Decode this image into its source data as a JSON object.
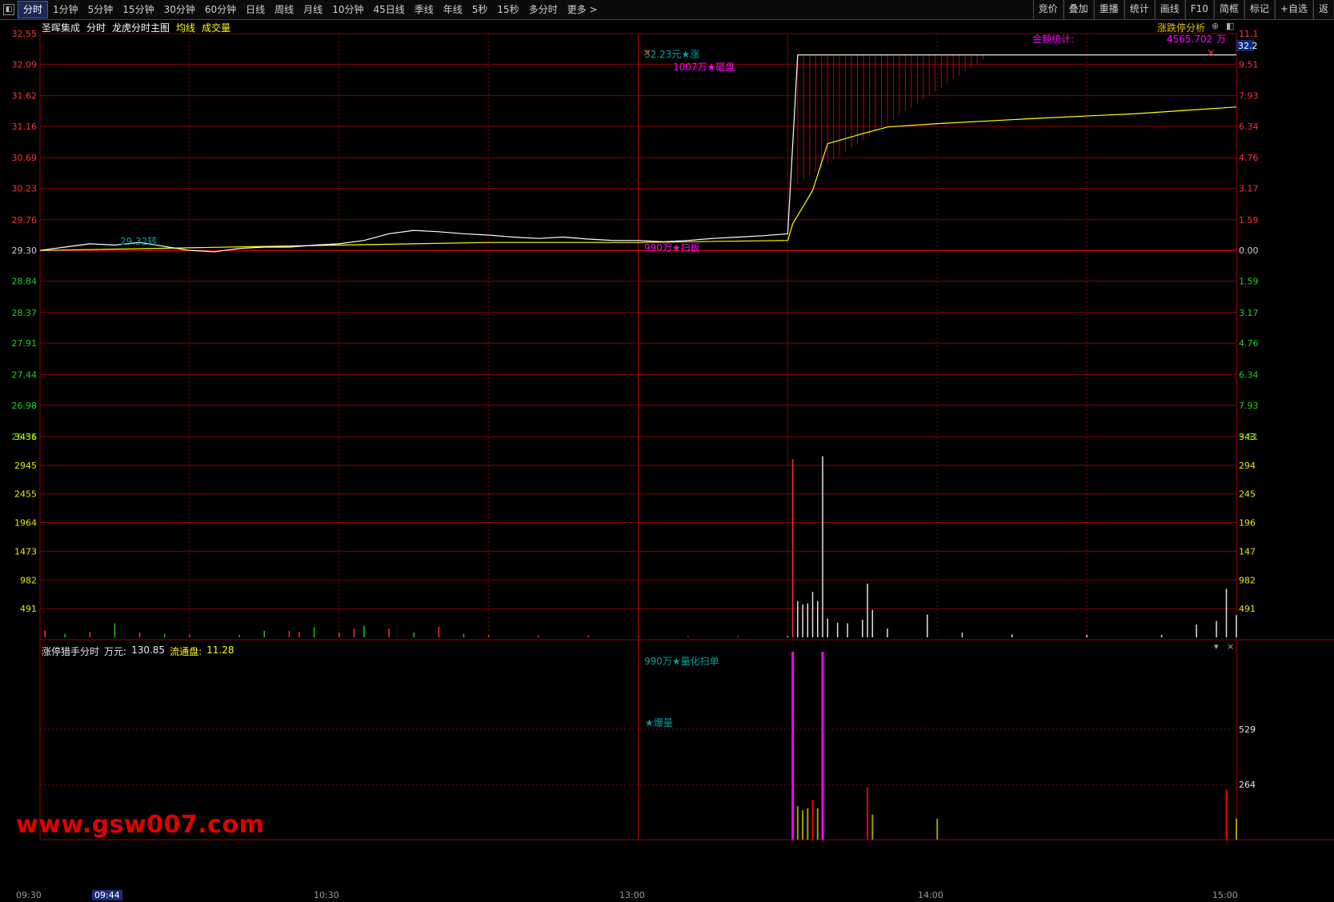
{
  "toolbar": {
    "tabs": [
      "分时",
      "1分钟",
      "5分钟",
      "15分钟",
      "30分钟",
      "60分钟",
      "日线",
      "周线",
      "月线",
      "10分钟",
      "45日线",
      "季线",
      "年线",
      "5秒",
      "15秒",
      "多分时",
      "更多 >"
    ],
    "active_tab": "分时",
    "right_buttons": [
      "竞价",
      "叠加",
      "重播",
      "统计",
      "画线",
      "F10",
      "简框",
      "标记",
      "+自选",
      "返"
    ]
  },
  "header": {
    "stock_name": "圣晖集成",
    "mode": "分时",
    "main_chart": "龙虎分时主图",
    "avg_line": "均线",
    "volume": "成交量",
    "right_title": "涨跌停分析",
    "zoom_glyph": "⊕",
    "panel_glyph": "◧"
  },
  "price_axis": {
    "left": [
      "32.55",
      "32.09",
      "31.62",
      "31.16",
      "30.69",
      "30.23",
      "29.76",
      "29.30",
      "28.84",
      "28.37",
      "27.91",
      "27.44",
      "26.98",
      "26.51"
    ],
    "right": [
      "11.1",
      "9.51",
      "7.93",
      "6.34",
      "4.76",
      "3.17",
      "1.59",
      "0.00",
      "1.59",
      "3.17",
      "4.76",
      "6.34",
      "7.93",
      "9.51"
    ],
    "current_price": "32.2"
  },
  "volume_axis": {
    "left": [
      "3436",
      "2945",
      "2455",
      "1964",
      "1473",
      "982",
      "491"
    ],
    "right": [
      "343",
      "294",
      "245",
      "196",
      "147",
      "982",
      "491"
    ]
  },
  "annotations": {
    "price_label_left": "29.32转",
    "limit_up_label": "32.23元★涨",
    "sell_label": "1007万★砸盘",
    "buy_label": "990万★扫板",
    "stat_label": "金额统计:",
    "stat_value": "4565.702",
    "stat_unit": "万"
  },
  "indicator": {
    "title": "涨停猎手分时",
    "unit_label": "万元:",
    "unit_value": "130.85",
    "float_label": "流通盘:",
    "float_value": "11.28",
    "label_top": "990万★量化扫单",
    "label_mid": "★爆量",
    "axis": [
      "529",
      "264"
    ],
    "menu_glyph": "▾",
    "close_glyph": "×"
  },
  "time_axis": [
    "09:30",
    "09:44",
    "10:30",
    "13:00",
    "14:00",
    "15:00"
  ],
  "watermark": "www.gsw007.com",
  "chart_data": {
    "type": "line",
    "prev_close": 29.3,
    "ylim": [
      26.51,
      32.55
    ],
    "price_series": [
      {
        "t": 0,
        "p": 29.3
      },
      {
        "t": 5,
        "p": 29.35
      },
      {
        "t": 10,
        "p": 29.4
      },
      {
        "t": 15,
        "p": 29.38
      },
      {
        "t": 20,
        "p": 29.42
      },
      {
        "t": 25,
        "p": 29.36
      },
      {
        "t": 30,
        "p": 29.3
      },
      {
        "t": 35,
        "p": 29.28
      },
      {
        "t": 40,
        "p": 29.33
      },
      {
        "t": 45,
        "p": 29.35
      },
      {
        "t": 50,
        "p": 29.35
      },
      {
        "t": 55,
        "p": 29.38
      },
      {
        "t": 60,
        "p": 29.4
      },
      {
        "t": 65,
        "p": 29.45
      },
      {
        "t": 70,
        "p": 29.55
      },
      {
        "t": 75,
        "p": 29.6
      },
      {
        "t": 80,
        "p": 29.58
      },
      {
        "t": 85,
        "p": 29.55
      },
      {
        "t": 90,
        "p": 29.53
      },
      {
        "t": 95,
        "p": 29.5
      },
      {
        "t": 100,
        "p": 29.48
      },
      {
        "t": 105,
        "p": 29.5
      },
      {
        "t": 110,
        "p": 29.47
      },
      {
        "t": 115,
        "p": 29.45
      },
      {
        "t": 120,
        "p": 29.45
      },
      {
        "t": 125,
        "p": 29.43
      },
      {
        "t": 130,
        "p": 29.45
      },
      {
        "t": 135,
        "p": 29.48
      },
      {
        "t": 140,
        "p": 29.5
      },
      {
        "t": 145,
        "p": 29.52
      },
      {
        "t": 150,
        "p": 29.55
      },
      {
        "t": 152,
        "p": 32.23
      },
      {
        "t": 240,
        "p": 32.23
      }
    ],
    "avg_series": [
      {
        "t": 0,
        "p": 29.3
      },
      {
        "t": 30,
        "p": 29.34
      },
      {
        "t": 60,
        "p": 29.38
      },
      {
        "t": 90,
        "p": 29.42
      },
      {
        "t": 120,
        "p": 29.42
      },
      {
        "t": 150,
        "p": 29.45
      },
      {
        "t": 151,
        "p": 29.7
      },
      {
        "t": 155,
        "p": 30.2
      },
      {
        "t": 158,
        "p": 30.9
      },
      {
        "t": 165,
        "p": 31.05
      },
      {
        "t": 170,
        "p": 31.15
      },
      {
        "t": 180,
        "p": 31.2
      },
      {
        "t": 200,
        "p": 31.28
      },
      {
        "t": 220,
        "p": 31.35
      },
      {
        "t": 240,
        "p": 31.45
      }
    ],
    "volume_ylim": [
      0,
      3436
    ],
    "volume_bars": [
      {
        "t": 1,
        "v": 120
      },
      {
        "t": 5,
        "v": 60
      },
      {
        "t": 10,
        "v": 90
      },
      {
        "t": 15,
        "v": 240
      },
      {
        "t": 20,
        "v": 80
      },
      {
        "t": 25,
        "v": 60
      },
      {
        "t": 30,
        "v": 50
      },
      {
        "t": 40,
        "v": 40
      },
      {
        "t": 45,
        "v": 110
      },
      {
        "t": 50,
        "v": 110
      },
      {
        "t": 52,
        "v": 90
      },
      {
        "t": 55,
        "v": 170
      },
      {
        "t": 60,
        "v": 80
      },
      {
        "t": 63,
        "v": 150
      },
      {
        "t": 65,
        "v": 200
      },
      {
        "t": 70,
        "v": 150
      },
      {
        "t": 75,
        "v": 80
      },
      {
        "t": 80,
        "v": 180
      },
      {
        "t": 85,
        "v": 60
      },
      {
        "t": 90,
        "v": 40
      },
      {
        "t": 100,
        "v": 30
      },
      {
        "t": 110,
        "v": 30
      },
      {
        "t": 120,
        "v": 20
      },
      {
        "t": 130,
        "v": 20
      },
      {
        "t": 140,
        "v": 20
      },
      {
        "t": 150,
        "v": 20
      },
      {
        "t": 151,
        "v": 3050
      },
      {
        "t": 152,
        "v": 620
      },
      {
        "t": 153,
        "v": 560
      },
      {
        "t": 154,
        "v": 580
      },
      {
        "t": 155,
        "v": 780
      },
      {
        "t": 156,
        "v": 620
      },
      {
        "t": 157,
        "v": 3100
      },
      {
        "t": 158,
        "v": 320
      },
      {
        "t": 160,
        "v": 250
      },
      {
        "t": 162,
        "v": 240
      },
      {
        "t": 165,
        "v": 300
      },
      {
        "t": 166,
        "v": 920
      },
      {
        "t": 167,
        "v": 470
      },
      {
        "t": 170,
        "v": 150
      },
      {
        "t": 178,
        "v": 390
      },
      {
        "t": 185,
        "v": 80
      },
      {
        "t": 195,
        "v": 50
      },
      {
        "t": 210,
        "v": 40
      },
      {
        "t": 225,
        "v": 40
      },
      {
        "t": 232,
        "v": 220
      },
      {
        "t": 236,
        "v": 280
      },
      {
        "t": 238,
        "v": 830
      },
      {
        "t": 240,
        "v": 380
      }
    ],
    "indicator_ylim": [
      0,
      900
    ],
    "indicator_bars": [
      {
        "t": 151,
        "v": 900,
        "c": "#ff00ff"
      },
      {
        "t": 152,
        "v": 160,
        "c": "#a0a000"
      },
      {
        "t": 153,
        "v": 140,
        "c": "#a0a000"
      },
      {
        "t": 154,
        "v": 150,
        "c": "#a0a000"
      },
      {
        "t": 155,
        "v": 190,
        "c": "#ff0000"
      },
      {
        "t": 156,
        "v": 150,
        "c": "#a0a000"
      },
      {
        "t": 157,
        "v": 900,
        "c": "#ff00ff"
      },
      {
        "t": 166,
        "v": 250,
        "c": "#ff0000"
      },
      {
        "t": 167,
        "v": 120,
        "c": "#a0a000"
      },
      {
        "t": 180,
        "v": 100,
        "c": "#a0a000"
      },
      {
        "t": 238,
        "v": 240,
        "c": "#ff0000"
      },
      {
        "t": 240,
        "v": 100,
        "c": "#a0a000"
      }
    ]
  }
}
